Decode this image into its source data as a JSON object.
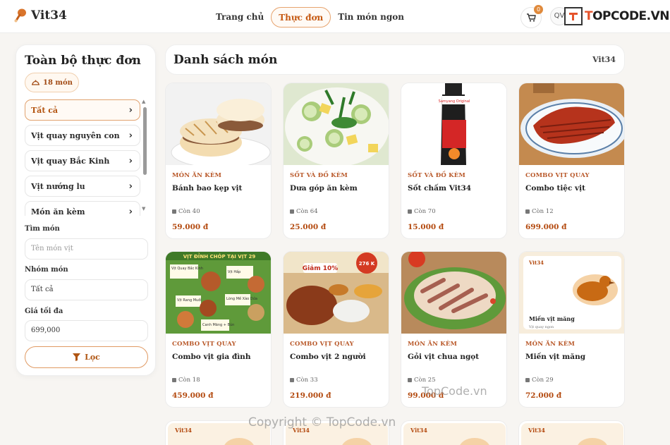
{
  "header": {
    "brand": "Vit34",
    "nav": [
      "Trang chủ",
      "Thực đơn",
      "Tin món ngon"
    ],
    "active_nav": "Thực đơn",
    "cart_count": "0",
    "avatar": "QV",
    "watermark_logo": "TOPCODE.VN"
  },
  "sidebar": {
    "title": "Toàn bộ thực đơn",
    "count": "18 món",
    "categories": [
      "Tất cả",
      "Vịt quay nguyên con",
      "Vịt quay Bắc Kinh",
      "Vịt nướng lu",
      "Món ăn kèm"
    ],
    "search_label": "Tìm món",
    "search_placeholder": "Tên món vịt",
    "group_label": "Nhóm món",
    "group_value": "Tất cả",
    "max_price_label": "Giá tối đa",
    "max_price_value": "699,000",
    "filter_button": "Lọc"
  },
  "main": {
    "title": "Danh sách món",
    "brand": "Vit34"
  },
  "products": [
    {
      "category": "MÓN ĂN KÈM",
      "name": "Bánh bao kẹp vịt",
      "stock": "Còn 40",
      "price": "59.000 đ"
    },
    {
      "category": "SỐT VÀ ĐỒ KÈM",
      "name": "Dưa góp ăn kèm",
      "stock": "Còn 64",
      "price": "25.000 đ"
    },
    {
      "category": "SỐT VÀ ĐỒ KÈM",
      "name": "Sốt chấm Vit34",
      "stock": "Còn 70",
      "price": "15.000 đ"
    },
    {
      "category": "COMBO VỊT QUAY",
      "name": "Combo tiệc vịt",
      "stock": "Còn 12",
      "price": "699.000 đ"
    },
    {
      "category": "COMBO VỊT QUAY",
      "name": "Combo vịt gia đình",
      "stock": "Còn 18",
      "price": "459.000 đ"
    },
    {
      "category": "COMBO VỊT QUAY",
      "name": "Combo vịt 2 người",
      "stock": "Còn 33",
      "price": "219.000 đ"
    },
    {
      "category": "MÓN ĂN KÈM",
      "name": "Gỏi vịt chua ngọt",
      "stock": "Còn 25",
      "price": "99.000 đ"
    },
    {
      "category": "MÓN ĂN KÈM",
      "name": "Miến vịt măng",
      "stock": "Còn 29",
      "price": "72.000 đ"
    }
  ],
  "image_text": {
    "sauce_label": "Samyang Original",
    "poster1_title": "VỊT ĐỈNH CHÓP TẠI VỊT 29",
    "poster1_items": [
      "Vịt Quay Bắc Kinh",
      "Vịt Hấp",
      "Vịt Rang Muối",
      "Lòng Mề Xào Dứa",
      "Canh Măng + Bún"
    ],
    "poster2_discount": "Giảm 10%",
    "poster2_price": "276 K",
    "placeholder_brand": "Vit34",
    "placeholder_title": "Miến vịt măng",
    "placeholder_sub": "Vịt quay ngon",
    "partial_tags": [
      "Vit34",
      "Vit34",
      "Vit34",
      "Vit34"
    ]
  },
  "watermarks": {
    "mid": "TopCode.vn",
    "footer": "Copyright © TopCode.vn"
  }
}
